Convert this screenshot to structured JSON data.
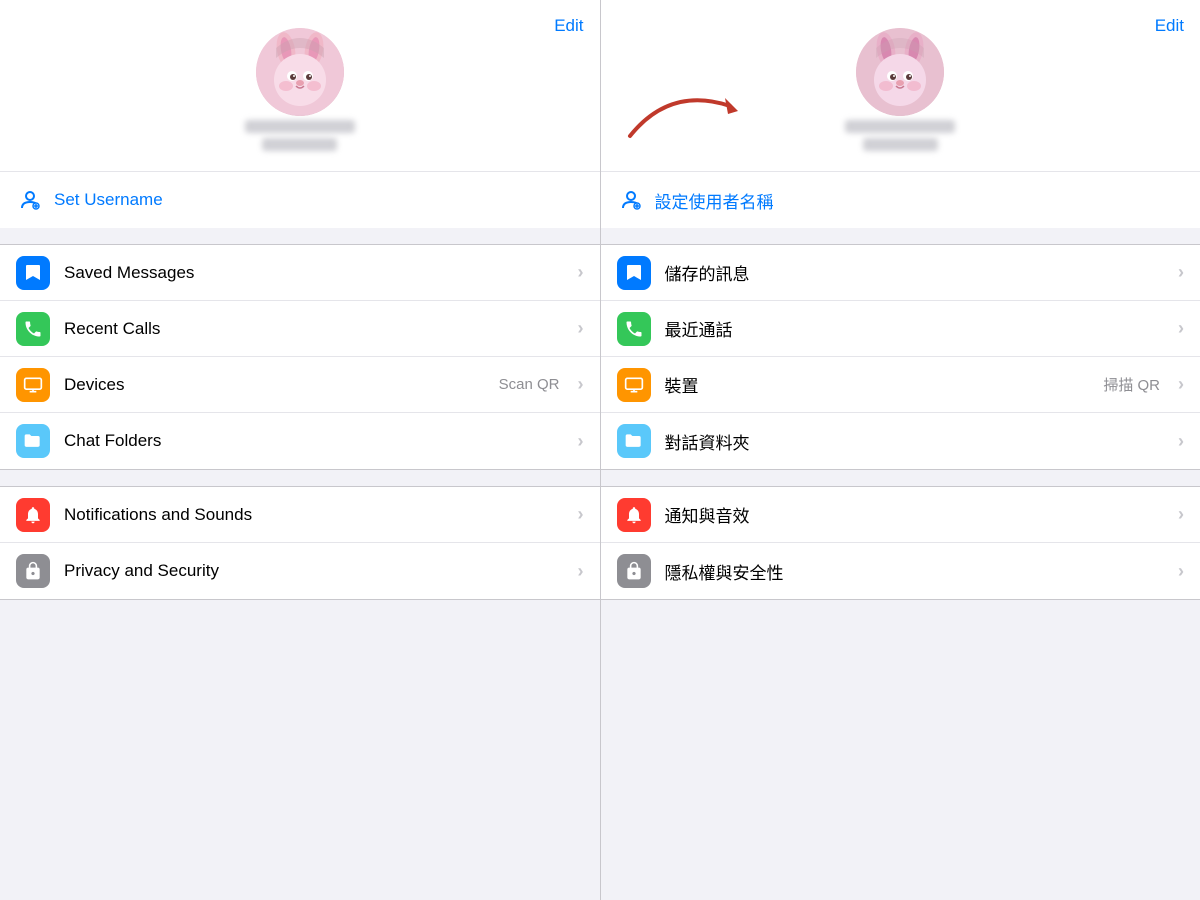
{
  "left": {
    "edit_label": "Edit",
    "username_icon": "👤",
    "username_label": "Set Username",
    "menu_items": [
      {
        "id": "saved-messages",
        "icon_char": "🔖",
        "icon_class": "icon-blue",
        "label": "Saved Messages",
        "secondary": "",
        "chevron": "›"
      },
      {
        "id": "recent-calls",
        "icon_char": "📞",
        "icon_class": "icon-green",
        "label": "Recent Calls",
        "secondary": "",
        "chevron": "›"
      },
      {
        "id": "devices",
        "icon_char": "💻",
        "icon_class": "icon-orange",
        "label": "Devices",
        "secondary": "Scan QR",
        "chevron": "›"
      },
      {
        "id": "chat-folders",
        "icon_char": "🗂",
        "icon_class": "icon-teal",
        "label": "Chat Folders",
        "secondary": "",
        "chevron": "›"
      }
    ],
    "section2_items": [
      {
        "id": "notifications",
        "icon_char": "🔔",
        "icon_class": "icon-red",
        "label": "Notifications and Sounds",
        "secondary": "",
        "chevron": "›"
      },
      {
        "id": "privacy",
        "icon_char": "🔒",
        "icon_class": "icon-gray",
        "label": "Privacy and Security",
        "secondary": "",
        "chevron": "›"
      }
    ]
  },
  "right": {
    "edit_label": "Edit",
    "username_icon": "👤",
    "username_label": "設定使用者名稱",
    "menu_items": [
      {
        "id": "saved-messages-zh",
        "icon_char": "🔖",
        "icon_class": "icon-blue",
        "label": "儲存的訊息",
        "secondary": "",
        "chevron": "›"
      },
      {
        "id": "recent-calls-zh",
        "icon_char": "📞",
        "icon_class": "icon-green",
        "label": "最近通話",
        "secondary": "",
        "chevron": "›"
      },
      {
        "id": "devices-zh",
        "icon_char": "💻",
        "icon_class": "icon-orange",
        "label": "裝置",
        "secondary": "掃描 QR",
        "chevron": "›"
      },
      {
        "id": "chat-folders-zh",
        "icon_char": "🗂",
        "icon_class": "icon-teal",
        "label": "對話資料夾",
        "secondary": "",
        "chevron": "›"
      }
    ],
    "section2_items": [
      {
        "id": "notifications-zh",
        "icon_char": "🔔",
        "icon_class": "icon-red",
        "label": "通知與音效",
        "secondary": "",
        "chevron": "›"
      },
      {
        "id": "privacy-zh",
        "icon_char": "🔒",
        "icon_class": "icon-gray",
        "label": "隱私權與安全性",
        "secondary": "",
        "chevron": "›"
      }
    ]
  },
  "icons": {
    "bookmark": "🔖",
    "phone": "📞",
    "laptop": "💻",
    "folder": "🗂",
    "bell": "🔔",
    "lock": "🔒",
    "user_circle": "⊙"
  },
  "colors": {
    "blue": "#007aff",
    "green": "#34c759",
    "orange": "#ff9500",
    "teal": "#5ac8fa",
    "red": "#ff3b30",
    "gray": "#8e8e93"
  }
}
